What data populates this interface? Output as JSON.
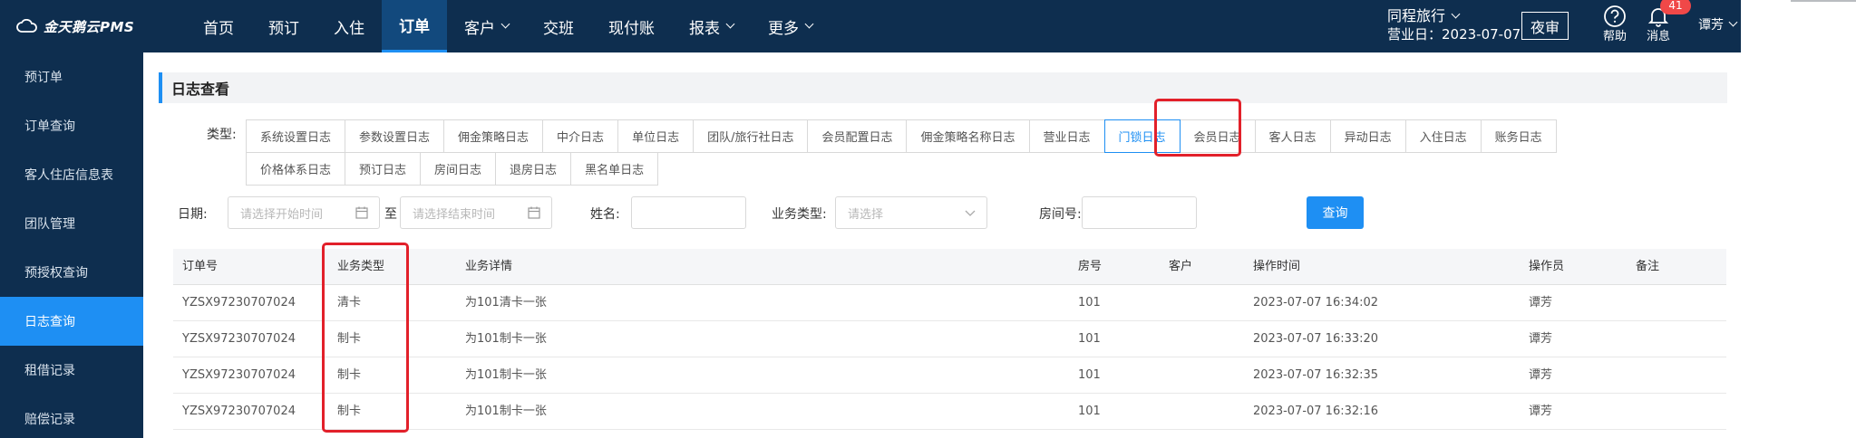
{
  "app": {
    "logo_text": "金天鹅云PMS",
    "accent_color": "#1e8ff3",
    "nav_bg": "#0e2e4f"
  },
  "nav": {
    "items": [
      {
        "label": "首页",
        "dropdown": false,
        "active": false
      },
      {
        "label": "预订",
        "dropdown": false,
        "active": false
      },
      {
        "label": "入住",
        "dropdown": false,
        "active": false
      },
      {
        "label": "订单",
        "dropdown": false,
        "active": true
      },
      {
        "label": "客户",
        "dropdown": true,
        "active": false
      },
      {
        "label": "交班",
        "dropdown": false,
        "active": false
      },
      {
        "label": "现付账",
        "dropdown": false,
        "active": false
      },
      {
        "label": "报表",
        "dropdown": true,
        "active": false
      },
      {
        "label": "更多",
        "dropdown": true,
        "active": false
      }
    ]
  },
  "header": {
    "hotel_name": "同程旅行",
    "business_date": "营业日：2023-07-07",
    "night_audit_label": "夜审",
    "help_label": "帮助",
    "messages_label": "消息",
    "messages_count": "41",
    "user_name": "谭芳"
  },
  "sidebar": {
    "items": [
      {
        "label": "预订单",
        "active": false
      },
      {
        "label": "订单查询",
        "active": false
      },
      {
        "label": "客人住店信息表",
        "active": false
      },
      {
        "label": "团队管理",
        "active": false
      },
      {
        "label": "预授权查询",
        "active": false
      },
      {
        "label": "日志查询",
        "active": true
      },
      {
        "label": "租借记录",
        "active": false
      },
      {
        "label": "赔偿记录",
        "active": false
      }
    ]
  },
  "page": {
    "title": "日志查看",
    "type_label": "类型:",
    "log_types_row1": [
      {
        "label": "系统设置日志",
        "active": false
      },
      {
        "label": "参数设置日志",
        "active": false
      },
      {
        "label": "佣金策略日志",
        "active": false
      },
      {
        "label": "中介日志",
        "active": false
      },
      {
        "label": "单位日志",
        "active": false
      },
      {
        "label": "团队/旅行社日志",
        "active": false
      },
      {
        "label": "会员配置日志",
        "active": false
      },
      {
        "label": "佣金策略名称日志",
        "active": false
      },
      {
        "label": "营业日志",
        "active": false
      },
      {
        "label": "门锁日志",
        "active": true
      },
      {
        "label": "会员日志",
        "active": false
      },
      {
        "label": "客人日志",
        "active": false
      },
      {
        "label": "异动日志",
        "active": false
      },
      {
        "label": "入住日志",
        "active": false
      },
      {
        "label": "账务日志",
        "active": false
      }
    ],
    "log_types_row2": [
      {
        "label": "价格体系日志",
        "active": false
      },
      {
        "label": "预订日志",
        "active": false
      },
      {
        "label": "房间日志",
        "active": false
      },
      {
        "label": "退房日志",
        "active": false
      },
      {
        "label": "黑名单日志",
        "active": false
      }
    ]
  },
  "filters": {
    "date_label": "日期:",
    "start_placeholder": "请选择开始时间",
    "range_separator": "至",
    "end_placeholder": "请选择结束时间",
    "name_label": "姓名:",
    "name_value": "",
    "biz_type_label": "业务类型:",
    "biz_type_placeholder": "请选择",
    "room_label": "房间号:",
    "room_value": "",
    "search_label": "查询"
  },
  "table": {
    "columns": [
      "订单号",
      "业务类型",
      "业务详情",
      "房号",
      "客户",
      "操作时间",
      "操作员",
      "备注"
    ],
    "rows": [
      [
        "YZSX97230707024",
        "清卡",
        "为101清卡一张",
        "101",
        "",
        "2023-07-07 16:34:02",
        "谭芳",
        ""
      ],
      [
        "YZSX97230707024",
        "制卡",
        "为101制卡一张",
        "101",
        "",
        "2023-07-07 16:33:20",
        "谭芳",
        ""
      ],
      [
        "YZSX97230707024",
        "制卡",
        "为101制卡一张",
        "101",
        "",
        "2023-07-07 16:32:35",
        "谭芳",
        ""
      ],
      [
        "YZSX97230707024",
        "制卡",
        "为101制卡一张",
        "101",
        "",
        "2023-07-07 16:32:16",
        "谭芳",
        ""
      ]
    ]
  }
}
